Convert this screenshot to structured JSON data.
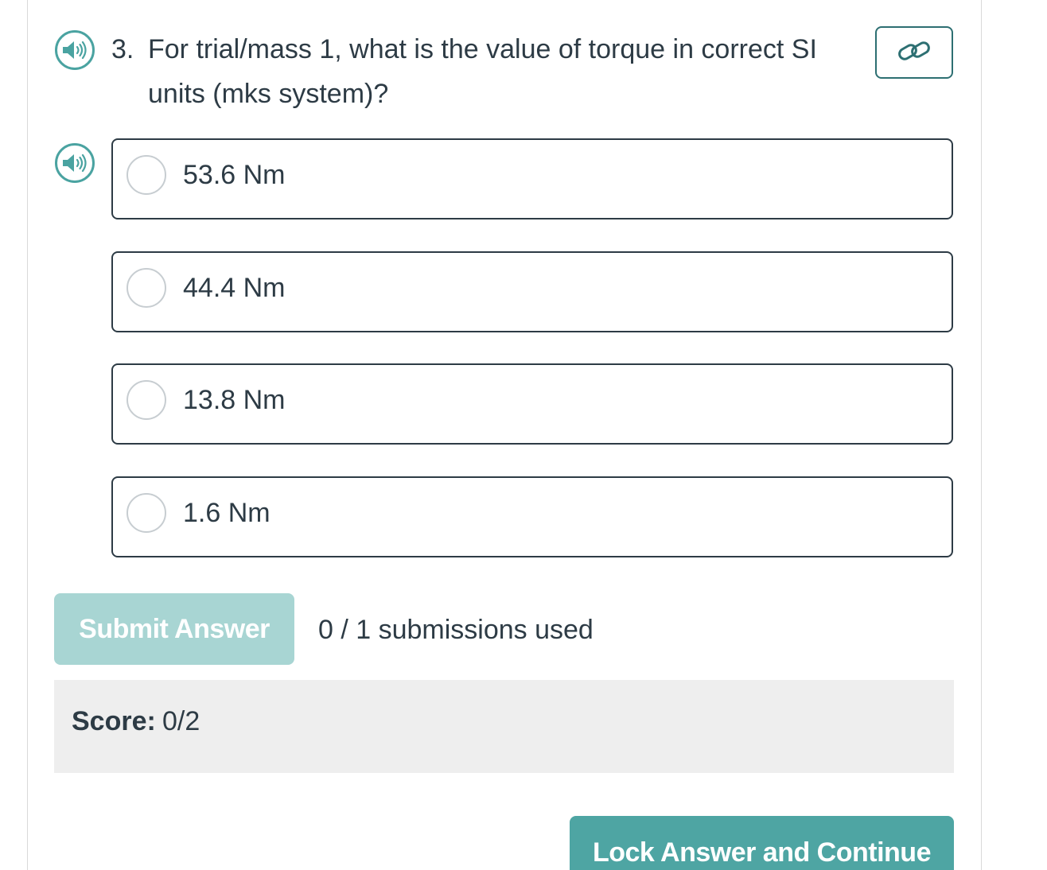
{
  "question": {
    "number": "3.",
    "text": "For trial/mass 1, what is the value of torque in correct SI units (mks system)?"
  },
  "icons": {
    "question_audio": "speaker-icon",
    "options_audio": "speaker-icon",
    "permalink": "link-icon"
  },
  "options": [
    {
      "label": "53.6 Nm",
      "selected": false
    },
    {
      "label": "44.4 Nm",
      "selected": false
    },
    {
      "label": "13.8 Nm",
      "selected": false
    },
    {
      "label": "1.6 Nm",
      "selected": false
    }
  ],
  "actions": {
    "submit_label": "Submit Answer",
    "submissions_text": "0 / 1 submissions used",
    "lock_label": "Lock Answer and Continue"
  },
  "score": {
    "label": "Score:",
    "value": "0/2"
  },
  "colors": {
    "accent": "#4ea5a3",
    "accent_disabled": "#a8d5d3",
    "text": "#2d3b45",
    "score_bg": "#eeeeee"
  }
}
